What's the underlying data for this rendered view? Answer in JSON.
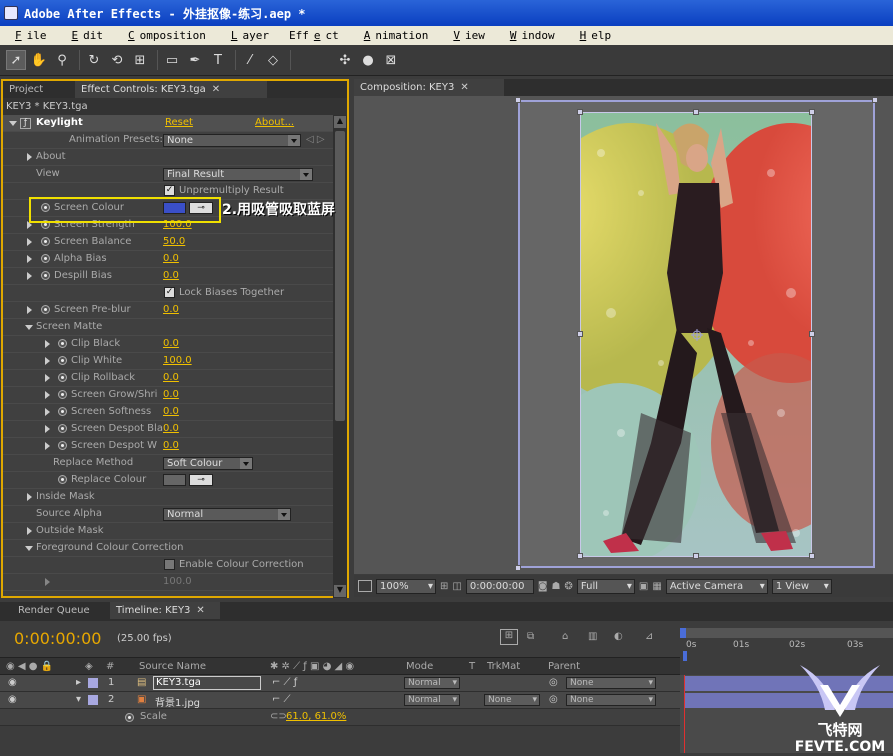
{
  "window": {
    "title": "Adobe After Effects - 外挂抠像-练习.aep *"
  },
  "menu": [
    {
      "pre": "",
      "u": "F",
      "post": "ile"
    },
    {
      "pre": "",
      "u": "E",
      "post": "dit"
    },
    {
      "pre": "",
      "u": "C",
      "post": "omposition"
    },
    {
      "pre": "",
      "u": "L",
      "post": "ayer"
    },
    {
      "pre": "Eff",
      "u": "e",
      "post": "ct"
    },
    {
      "pre": "",
      "u": "A",
      "post": "nimation"
    },
    {
      "pre": "",
      "u": "V",
      "post": "iew"
    },
    {
      "pre": "",
      "u": "W",
      "post": "indow"
    },
    {
      "pre": "",
      "u": "H",
      "post": "elp"
    }
  ],
  "left_tabs": {
    "project": "Project",
    "effect_controls": "Effect Controls: KEY3.tga"
  },
  "crumb": "KEY3 * KEY3.tga",
  "effect": {
    "name": "Keylight",
    "reset": "Reset",
    "about_link": "About...",
    "presets_label": "Animation Presets:",
    "presets_value": "None",
    "rows": {
      "about": "About",
      "view": "View",
      "view_value": "Final Result",
      "unpremultiply": "Unpremultiply Result",
      "screen_colour": "Screen Colour",
      "screen_strength": "Screen Strength",
      "screen_strength_v": "100.0",
      "screen_balance": "Screen Balance",
      "screen_balance_v": "50.0",
      "alpha_bias": "Alpha Bias",
      "alpha_bias_v": "0.0",
      "despill_bias": "Despill Bias",
      "despill_bias_v": "0.0",
      "lock_biases": "Lock Biases Together",
      "screen_preblur": "Screen Pre-blur",
      "screen_preblur_v": "0.0",
      "screen_matte": "Screen Matte",
      "clip_black": "Clip Black",
      "clip_black_v": "0.0",
      "clip_white": "Clip White",
      "clip_white_v": "100.0",
      "clip_rollback": "Clip Rollback",
      "clip_rollback_v": "0.0",
      "screen_grow": "Screen Grow/Shri",
      "screen_grow_v": "0.0",
      "screen_softness": "Screen Softness",
      "screen_softness_v": "0.0",
      "screen_despot_bla": "Screen Despot Bla",
      "screen_despot_bla_v": "0.0",
      "screen_despot_w": "Screen Despot W",
      "screen_despot_w_v": "0.0",
      "replace_method": "Replace Method",
      "replace_method_v": "Soft Colour",
      "replace_colour": "Replace Colour",
      "inside_mask": "Inside Mask",
      "source_alpha": "Source Alpha",
      "source_alpha_v": "Normal",
      "outside_mask": "Outside Mask",
      "fg_colour_correction": "Foreground Colour Correction",
      "enable_colour_correction": "Enable Colour Correction",
      "faded_v": "100.0"
    }
  },
  "annotation": "2.用吸管吸取蓝屏",
  "comp": {
    "tab": "Composition: KEY3",
    "zoom": "100%",
    "timecode": "0:00:00:00",
    "resolution": "Full",
    "camera": "Active Camera",
    "views": "1 View"
  },
  "timeline": {
    "render_queue": "Render Queue",
    "tab": "Timeline: KEY3",
    "timecode": "0:00:00:00",
    "fps": "(25.00 fps)",
    "cols": {
      "num": "#",
      "source": "Source Name",
      "mode": "Mode",
      "t": "T",
      "trkmat": "TrkMat",
      "parent": "Parent"
    },
    "layers": [
      {
        "num": "1",
        "name": "KEY3.tga",
        "mode": "Normal",
        "trkmat": "",
        "parent": "None"
      },
      {
        "num": "2",
        "name": "背景1.jpg",
        "mode": "Normal",
        "trkmat": "None",
        "parent": "None"
      }
    ],
    "scale_label": "Scale",
    "scale_value": "61.0, 61.0%",
    "ruler": [
      "0s",
      "01s",
      "02s",
      "03s"
    ]
  },
  "watermark": {
    "cn": "飞特网",
    "en": "FEVTE.COM"
  },
  "colors": {
    "accent": "#e0a800",
    "value": "#f0c000",
    "screen_colour": "#3a4fc8",
    "annotation_box": "#f0e000"
  }
}
